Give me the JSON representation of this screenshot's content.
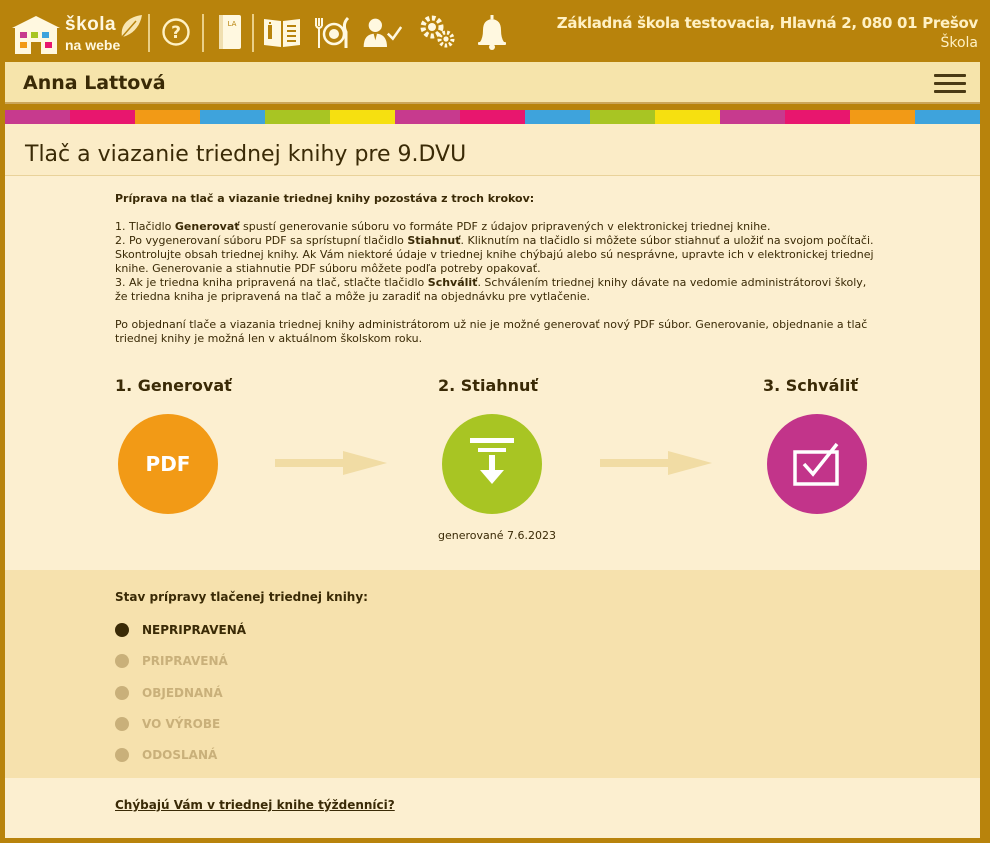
{
  "header": {
    "logo_line1": "škola",
    "logo_line2": "na webe",
    "school_address": "Základná škola testovacia, Hlavná 2, 080 01 Prešov",
    "school_role": "Škola",
    "icons": [
      "help-icon",
      "class-book-icon",
      "open-book-icon",
      "canteen-icon",
      "user-check-icon",
      "settings-icon",
      "notifications-bell-icon"
    ]
  },
  "user": {
    "name": "Anna Lattová"
  },
  "stripe_colors": [
    "#c73a8e",
    "#e8166e",
    "#f29a16",
    "#3ea3dc",
    "#a8c523",
    "#f6e010",
    "#c73a8e",
    "#e8166e",
    "#3ea3dc",
    "#a8c523",
    "#f6e010",
    "#c73a8e",
    "#e8166e",
    "#f29a16",
    "#3ea3dc"
  ],
  "page": {
    "title": "Tlač a viazanie triednej knihy pre 9.DVU"
  },
  "instructions": {
    "intro": "Príprava na tlač a viazanie triednej knihy pozostáva z troch krokov:",
    "step1_a": "1. Tlačidlo ",
    "step1_bold": "Generovať",
    "step1_b": " spustí generovanie súboru vo formáte PDF z údajov pripravených v elektronickej triednej knihe.",
    "step2_a": "2. Po vygenerovaní súboru PDF sa sprístupní tlačidlo ",
    "step2_bold": "Stiahnuť",
    "step2_b": ". Kliknutím na tlačidlo si môžete súbor stiahnuť a uložiť na svojom počítači. Skontrolujte obsah triednej knihy. Ak Vám niektoré údaje v triednej knihe chýbajú alebo sú nesprávne, upravte ich v elektronickej triednej knihe. Generovanie a stiahnutie PDF súboru môžete podľa potreby opakovať.",
    "step3_a": "3. Ak je triedna kniha pripravená na tlač, stlačte tlačidlo ",
    "step3_bold": "Schváliť",
    "step3_b": ". Schválením triednej knihy dávate na vedomie administrátorovi školy, že triedna kniha je pripravená na tlač a môže ju zaradiť na objednávku pre vytlačenie.",
    "note": "Po objednaní tlače a viazania triednej knihy administrátorom už nie je možné generovať nový PDF súbor. Generovanie, objednanie a tlač triednej knihy je možná len v aktuálnom školskom roku."
  },
  "steps": [
    {
      "title": "1. Generovať",
      "button_text": "PDF",
      "color": "#f29a16"
    },
    {
      "title": "2. Stiahnuť",
      "color": "#a8c523",
      "icon": "download-icon",
      "caption": "generované 7.6.2023"
    },
    {
      "title": "3. Schváliť",
      "color": "#c2348a",
      "icon": "approve-checkbox-icon"
    }
  ],
  "status": {
    "title": "Stav prípravy tlačenej triednej knihy:",
    "items": [
      {
        "label": "NEPRIPRAVENÁ",
        "active": true
      },
      {
        "label": "PRIPRAVENÁ",
        "active": false
      },
      {
        "label": "OBJEDNANÁ",
        "active": false
      },
      {
        "label": "VO VÝROBE",
        "active": false
      },
      {
        "label": "ODOSLANÁ",
        "active": false
      }
    ],
    "active_color": "#3a2a06",
    "inactive_color": "#c9b07a"
  },
  "missing_link": "Chýbajú Vám v triednej knihe týždenníci?"
}
